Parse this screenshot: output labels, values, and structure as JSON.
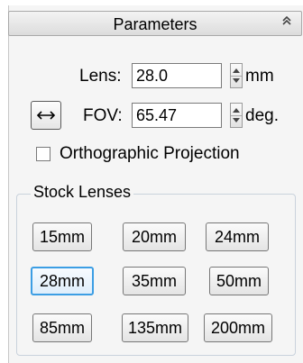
{
  "panel": {
    "title": "Parameters",
    "collapse_glyph": "≈"
  },
  "lens": {
    "label": "Lens:",
    "value": "28.0",
    "unit": "mm"
  },
  "fov": {
    "direction_icon": "horizontal-arrows-icon",
    "label": "FOV:",
    "value": "65.47",
    "unit": "deg."
  },
  "ortho": {
    "label": "Orthographic Projection",
    "checked": false
  },
  "stock_lenses": {
    "title": "Stock Lenses",
    "buttons": [
      "15mm",
      "20mm",
      "24mm",
      "28mm",
      "35mm",
      "50mm",
      "85mm",
      "135mm",
      "200mm"
    ],
    "selected": "28mm"
  }
}
